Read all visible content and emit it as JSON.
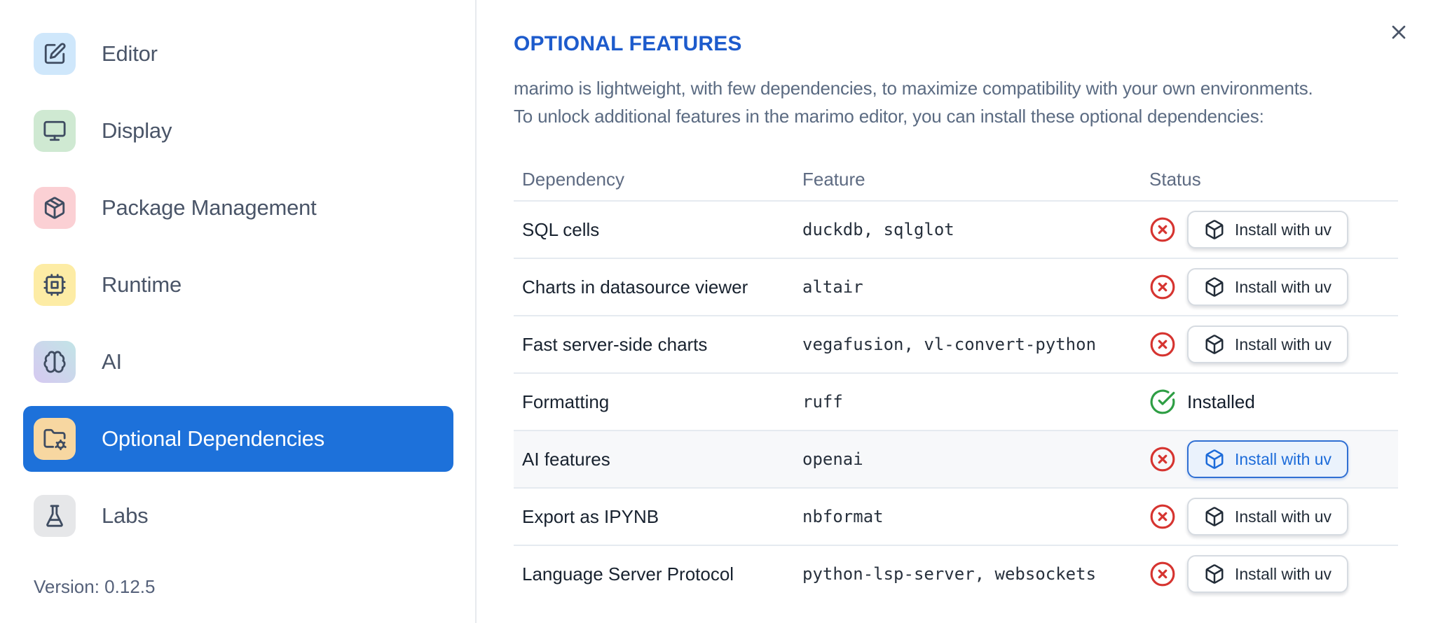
{
  "dialog": {
    "close_icon": "close-icon"
  },
  "sidebar": {
    "items": [
      {
        "label": "Editor",
        "icon": "square-pen-icon",
        "tile_bg": "#cfe7fb",
        "selected": false
      },
      {
        "label": "Display",
        "icon": "monitor-icon",
        "tile_bg": "#cfe9d2",
        "selected": false
      },
      {
        "label": "Package Management",
        "icon": "package-icon",
        "tile_bg": "#fbd0d4",
        "selected": false
      },
      {
        "label": "Runtime",
        "icon": "cpu-icon",
        "tile_bg": "#fdeca5",
        "selected": false
      },
      {
        "label": "AI",
        "icon": "brain-icon",
        "tile_bg": "#d6c9f1",
        "tile_bg2": "#c2e4e6",
        "selected": false
      },
      {
        "label": "Optional Dependencies",
        "icon": "folder-cog-icon",
        "tile_bg": "#f7d7a1",
        "selected": true
      },
      {
        "label": "Labs",
        "icon": "flask-icon",
        "tile_bg": "#e6e7e9",
        "selected": false
      }
    ],
    "version_label": "Version: 0.12.5"
  },
  "main": {
    "title": "OPTIONAL FEATURES",
    "description_line1": "marimo is lightweight, with few dependencies, to maximize compatibility with your own environments.",
    "description_line2": "To unlock additional features in the marimo editor, you can install these optional dependencies:",
    "table": {
      "columns": [
        "Dependency",
        "Feature",
        "Status"
      ],
      "install_button_label": "Install with uv",
      "install_button_icon": "box-icon",
      "installed_label": "Installed",
      "rows": [
        {
          "dependency": "SQL cells",
          "feature": "duckdb, sqlglot",
          "installed": false,
          "status_icon": "circle-x-icon",
          "highlighted": false
        },
        {
          "dependency": "Charts in datasource viewer",
          "feature": "altair",
          "installed": false,
          "status_icon": "circle-x-icon",
          "highlighted": false
        },
        {
          "dependency": "Fast server-side charts",
          "feature": "vegafusion, vl-convert-python",
          "installed": false,
          "status_icon": "circle-x-icon",
          "highlighted": false
        },
        {
          "dependency": "Formatting",
          "feature": "ruff",
          "installed": true,
          "status_icon": "circle-check-icon",
          "highlighted": false
        },
        {
          "dependency": "AI features",
          "feature": "openai",
          "installed": false,
          "status_icon": "circle-x-icon",
          "highlighted": true
        },
        {
          "dependency": "Export as IPYNB",
          "feature": "nbformat",
          "installed": false,
          "status_icon": "circle-x-icon",
          "highlighted": false
        },
        {
          "dependency": "Language Server Protocol",
          "feature": "python-lsp-server, websockets",
          "installed": false,
          "status_icon": "circle-x-icon",
          "highlighted": false
        }
      ]
    }
  },
  "colors": {
    "accent_blue": "#1d71da",
    "heading_blue": "#1d5bcc",
    "error_red": "#d63430",
    "success_green": "#2e9e44",
    "row_border": "#e5eaf0",
    "muted_text": "#5b6b82"
  }
}
